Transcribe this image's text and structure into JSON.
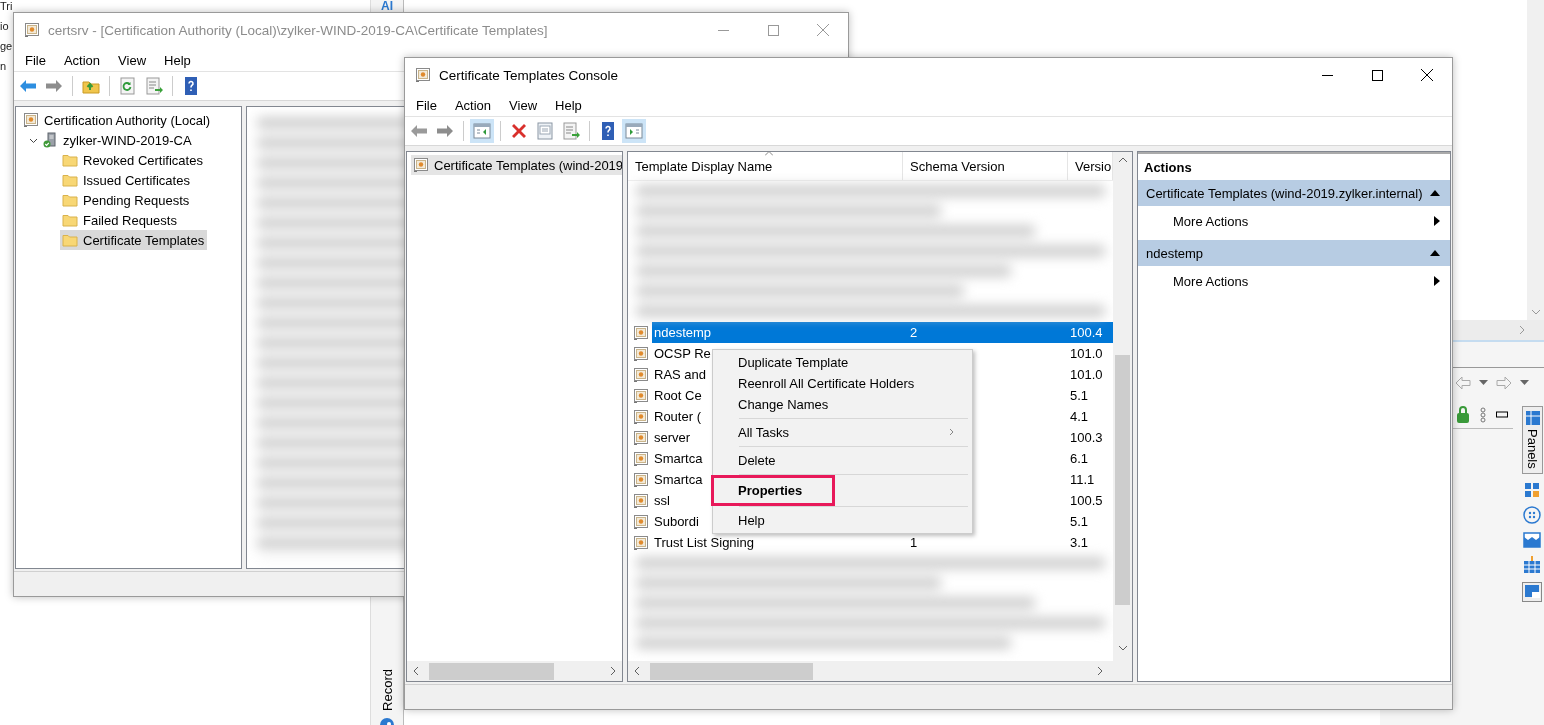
{
  "desktop": {
    "fragments": [
      "Tri",
      "io",
      "ge",
      "n"
    ],
    "top_label": "AI",
    "side_tab": "Record"
  },
  "side_app": {
    "tab": "Panels"
  },
  "back_window": {
    "title": "certsrv - [Certification Authority (Local)\\zylker-WIND-2019-CA\\Certificate Templates]",
    "active": false,
    "menu": [
      "File",
      "Action",
      "View",
      "Help"
    ],
    "toolbar": [
      {
        "kind": "back",
        "disabled": false,
        "pressed": false
      },
      {
        "kind": "forward",
        "disabled": true,
        "pressed": false
      },
      {
        "kind": "separator"
      },
      {
        "kind": "up",
        "pressed": false
      },
      {
        "kind": "separator"
      },
      {
        "kind": "refresh",
        "pressed": false
      },
      {
        "kind": "export",
        "pressed": false
      },
      {
        "kind": "separator"
      },
      {
        "kind": "help",
        "pressed": false
      }
    ],
    "tree": [
      {
        "label": "Certification Authority (Local)",
        "kind": "authority",
        "selected": false,
        "children": [
          {
            "label": "zylker-WIND-2019-CA",
            "kind": "server",
            "expanded": true,
            "selected": false,
            "children": [
              {
                "label": "Revoked Certificates",
                "kind": "folder",
                "selected": false
              },
              {
                "label": "Issued Certificates",
                "kind": "folder",
                "selected": false
              },
              {
                "label": "Pending Requests",
                "kind": "folder",
                "selected": false
              },
              {
                "label": "Failed Requests",
                "kind": "folder",
                "selected": false
              },
              {
                "label": "Certificate Templates",
                "kind": "folder",
                "selected": true
              }
            ]
          }
        ]
      }
    ]
  },
  "front_window": {
    "title": "Certificate Templates Console",
    "active": true,
    "menu": [
      "File",
      "Action",
      "View",
      "Help"
    ],
    "toolbar": [
      {
        "kind": "back",
        "disabled": true,
        "pressed": false
      },
      {
        "kind": "forward",
        "disabled": true,
        "pressed": false
      },
      {
        "kind": "separator"
      },
      {
        "kind": "tree-toggle",
        "pressed": true
      },
      {
        "kind": "separator"
      },
      {
        "kind": "delete",
        "pressed": false
      },
      {
        "kind": "properties",
        "pressed": false
      },
      {
        "kind": "export",
        "pressed": false
      },
      {
        "kind": "separator"
      },
      {
        "kind": "help",
        "pressed": false
      },
      {
        "kind": "action-toggle",
        "pressed": true
      }
    ],
    "tree": [
      {
        "label": "Certificate Templates (wind-2019",
        "kind": "authority",
        "selected": true
      }
    ],
    "table": {
      "columns": [
        {
          "label": "Template Display Name",
          "sorted": true
        },
        {
          "label": "Schema Version",
          "sorted": false
        },
        {
          "label": "Versio",
          "sorted": false
        }
      ],
      "rows": [
        {
          "name": "ndestemp",
          "schema": "2",
          "version": "100.4",
          "selected": true
        },
        {
          "name": "OCSP Re",
          "version": "101.0",
          "selected": false
        },
        {
          "name": "RAS and",
          "version": "101.0",
          "selected": false
        },
        {
          "name": "Root Ce",
          "version": "5.1",
          "selected": false
        },
        {
          "name": "Router (",
          "version": "4.1",
          "selected": false
        },
        {
          "name": "server",
          "version": "100.3",
          "selected": false
        },
        {
          "name": "Smartca",
          "version": "6.1",
          "selected": false
        },
        {
          "name": "Smartca",
          "version": "11.1",
          "selected": false
        },
        {
          "name": "ssl",
          "version": "100.5",
          "selected": false
        },
        {
          "name": "Subordi",
          "version": "5.1",
          "selected": false
        },
        {
          "name": "Trust List Signing",
          "schema": "1",
          "version": "3.1",
          "selected": false
        }
      ]
    },
    "context_menu": [
      {
        "kind": "item",
        "label": "Duplicate Template",
        "bold": false,
        "annotated": false,
        "submenu": false
      },
      {
        "kind": "item",
        "label": "Reenroll All Certificate Holders",
        "bold": false,
        "annotated": false,
        "submenu": false
      },
      {
        "kind": "item",
        "label": "Change Names",
        "bold": false,
        "annotated": false,
        "submenu": false
      },
      {
        "kind": "separator"
      },
      {
        "kind": "item",
        "label": "All Tasks",
        "bold": false,
        "annotated": false,
        "submenu": true
      },
      {
        "kind": "separator"
      },
      {
        "kind": "item",
        "label": "Delete",
        "bold": false,
        "annotated": false,
        "submenu": false
      },
      {
        "kind": "separator"
      },
      {
        "kind": "item",
        "label": "Properties",
        "bold": true,
        "annotated": true,
        "submenu": false
      },
      {
        "kind": "separator"
      },
      {
        "kind": "item",
        "label": "Help",
        "bold": false,
        "annotated": false,
        "submenu": false
      }
    ],
    "actions": {
      "title": "Actions",
      "groups": [
        {
          "title": "Certificate Templates (wind-2019.zylker.internal)",
          "expanded": true,
          "items": [
            {
              "label": "More Actions",
              "submenu": true
            }
          ]
        },
        {
          "title": "ndestemp",
          "expanded": true,
          "items": [
            {
              "label": "More Actions",
              "submenu": true
            }
          ]
        }
      ]
    }
  }
}
